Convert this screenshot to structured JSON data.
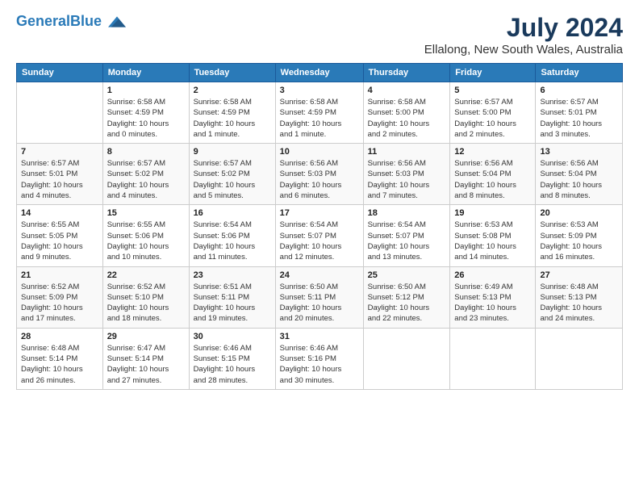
{
  "logo": {
    "line1": "General",
    "line2": "Blue"
  },
  "title": "July 2024",
  "subtitle": "Ellalong, New South Wales, Australia",
  "days_header": [
    "Sunday",
    "Monday",
    "Tuesday",
    "Wednesday",
    "Thursday",
    "Friday",
    "Saturday"
  ],
  "weeks": [
    [
      {
        "day": "",
        "info": ""
      },
      {
        "day": "1",
        "info": "Sunrise: 6:58 AM\nSunset: 4:59 PM\nDaylight: 10 hours\nand 0 minutes."
      },
      {
        "day": "2",
        "info": "Sunrise: 6:58 AM\nSunset: 4:59 PM\nDaylight: 10 hours\nand 1 minute."
      },
      {
        "day": "3",
        "info": "Sunrise: 6:58 AM\nSunset: 4:59 PM\nDaylight: 10 hours\nand 1 minute."
      },
      {
        "day": "4",
        "info": "Sunrise: 6:58 AM\nSunset: 5:00 PM\nDaylight: 10 hours\nand 2 minutes."
      },
      {
        "day": "5",
        "info": "Sunrise: 6:57 AM\nSunset: 5:00 PM\nDaylight: 10 hours\nand 2 minutes."
      },
      {
        "day": "6",
        "info": "Sunrise: 6:57 AM\nSunset: 5:01 PM\nDaylight: 10 hours\nand 3 minutes."
      }
    ],
    [
      {
        "day": "7",
        "info": "Sunrise: 6:57 AM\nSunset: 5:01 PM\nDaylight: 10 hours\nand 4 minutes."
      },
      {
        "day": "8",
        "info": "Sunrise: 6:57 AM\nSunset: 5:02 PM\nDaylight: 10 hours\nand 4 minutes."
      },
      {
        "day": "9",
        "info": "Sunrise: 6:57 AM\nSunset: 5:02 PM\nDaylight: 10 hours\nand 5 minutes."
      },
      {
        "day": "10",
        "info": "Sunrise: 6:56 AM\nSunset: 5:03 PM\nDaylight: 10 hours\nand 6 minutes."
      },
      {
        "day": "11",
        "info": "Sunrise: 6:56 AM\nSunset: 5:03 PM\nDaylight: 10 hours\nand 7 minutes."
      },
      {
        "day": "12",
        "info": "Sunrise: 6:56 AM\nSunset: 5:04 PM\nDaylight: 10 hours\nand 8 minutes."
      },
      {
        "day": "13",
        "info": "Sunrise: 6:56 AM\nSunset: 5:04 PM\nDaylight: 10 hours\nand 8 minutes."
      }
    ],
    [
      {
        "day": "14",
        "info": "Sunrise: 6:55 AM\nSunset: 5:05 PM\nDaylight: 10 hours\nand 9 minutes."
      },
      {
        "day": "15",
        "info": "Sunrise: 6:55 AM\nSunset: 5:06 PM\nDaylight: 10 hours\nand 10 minutes."
      },
      {
        "day": "16",
        "info": "Sunrise: 6:54 AM\nSunset: 5:06 PM\nDaylight: 10 hours\nand 11 minutes."
      },
      {
        "day": "17",
        "info": "Sunrise: 6:54 AM\nSunset: 5:07 PM\nDaylight: 10 hours\nand 12 minutes."
      },
      {
        "day": "18",
        "info": "Sunrise: 6:54 AM\nSunset: 5:07 PM\nDaylight: 10 hours\nand 13 minutes."
      },
      {
        "day": "19",
        "info": "Sunrise: 6:53 AM\nSunset: 5:08 PM\nDaylight: 10 hours\nand 14 minutes."
      },
      {
        "day": "20",
        "info": "Sunrise: 6:53 AM\nSunset: 5:09 PM\nDaylight: 10 hours\nand 16 minutes."
      }
    ],
    [
      {
        "day": "21",
        "info": "Sunrise: 6:52 AM\nSunset: 5:09 PM\nDaylight: 10 hours\nand 17 minutes."
      },
      {
        "day": "22",
        "info": "Sunrise: 6:52 AM\nSunset: 5:10 PM\nDaylight: 10 hours\nand 18 minutes."
      },
      {
        "day": "23",
        "info": "Sunrise: 6:51 AM\nSunset: 5:11 PM\nDaylight: 10 hours\nand 19 minutes."
      },
      {
        "day": "24",
        "info": "Sunrise: 6:50 AM\nSunset: 5:11 PM\nDaylight: 10 hours\nand 20 minutes."
      },
      {
        "day": "25",
        "info": "Sunrise: 6:50 AM\nSunset: 5:12 PM\nDaylight: 10 hours\nand 22 minutes."
      },
      {
        "day": "26",
        "info": "Sunrise: 6:49 AM\nSunset: 5:13 PM\nDaylight: 10 hours\nand 23 minutes."
      },
      {
        "day": "27",
        "info": "Sunrise: 6:48 AM\nSunset: 5:13 PM\nDaylight: 10 hours\nand 24 minutes."
      }
    ],
    [
      {
        "day": "28",
        "info": "Sunrise: 6:48 AM\nSunset: 5:14 PM\nDaylight: 10 hours\nand 26 minutes."
      },
      {
        "day": "29",
        "info": "Sunrise: 6:47 AM\nSunset: 5:14 PM\nDaylight: 10 hours\nand 27 minutes."
      },
      {
        "day": "30",
        "info": "Sunrise: 6:46 AM\nSunset: 5:15 PM\nDaylight: 10 hours\nand 28 minutes."
      },
      {
        "day": "31",
        "info": "Sunrise: 6:46 AM\nSunset: 5:16 PM\nDaylight: 10 hours\nand 30 minutes."
      },
      {
        "day": "",
        "info": ""
      },
      {
        "day": "",
        "info": ""
      },
      {
        "day": "",
        "info": ""
      }
    ]
  ]
}
